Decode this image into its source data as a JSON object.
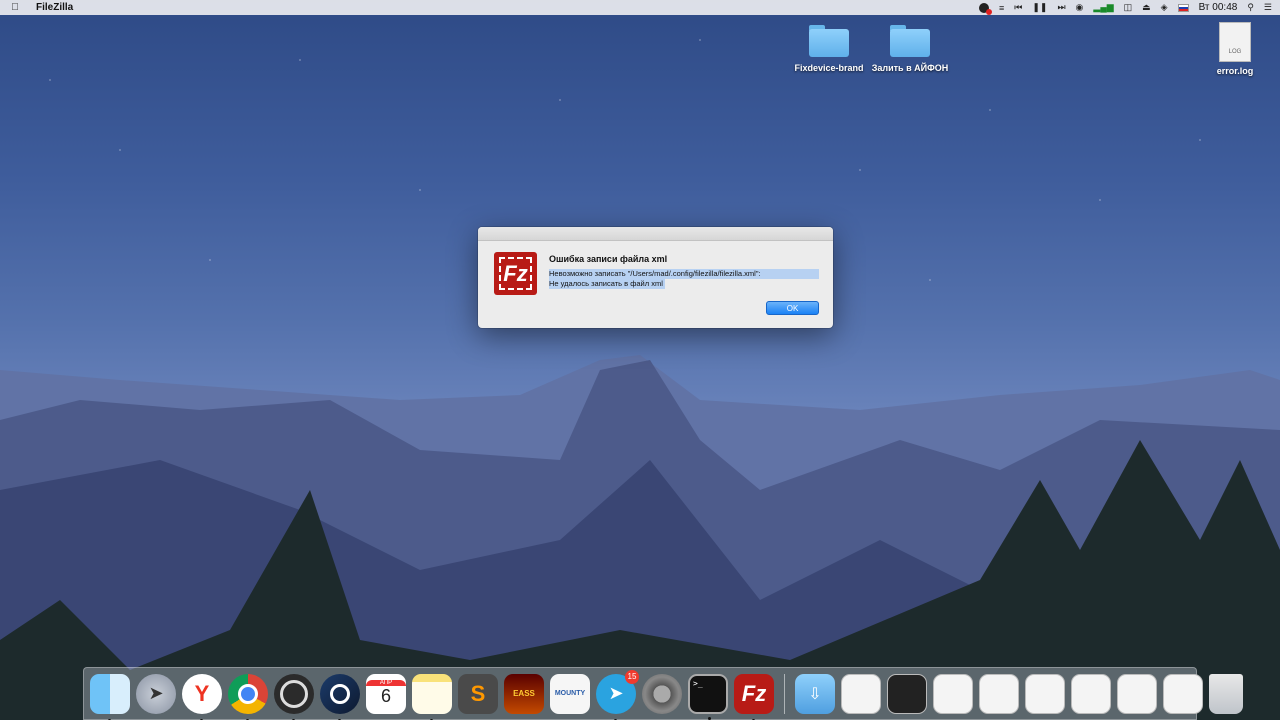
{
  "menubar": {
    "app_name": "FileZilla",
    "clock": "Вт 00:48"
  },
  "desktop": {
    "icons": [
      {
        "label": "Fixdevice-brand",
        "type": "folder"
      },
      {
        "label": "Залить в АЙФОН",
        "type": "folder"
      },
      {
        "label": "error.log",
        "type": "document",
        "badge": "LOG"
      }
    ]
  },
  "dialog": {
    "title": "Ошибка записи файла xml",
    "message_line1": "Невозможно записать \"/Users/mad/.config/filezilla/filezilla.xml\":",
    "message_line2": "Не удалось записать в файл xml",
    "ok_label": "OK",
    "icon": "filezilla-logo-icon",
    "logo_text": "Fz"
  },
  "dock": {
    "apps": [
      {
        "name": "finder-icon",
        "running": true
      },
      {
        "name": "launchpad-icon",
        "running": false
      },
      {
        "name": "yandex-browser-icon",
        "running": true
      },
      {
        "name": "chrome-icon",
        "running": true
      },
      {
        "name": "obs-icon",
        "running": true
      },
      {
        "name": "steam-icon",
        "running": true
      },
      {
        "name": "calendar-icon",
        "running": false,
        "month": "АПР",
        "day": "6"
      },
      {
        "name": "notes-icon",
        "running": true
      },
      {
        "name": "sublime-text-icon",
        "running": false
      },
      {
        "name": "game-icon",
        "running": false,
        "text": "EASS"
      },
      {
        "name": "mounty-icon",
        "running": false,
        "text": "MOUNTY"
      },
      {
        "name": "telegram-icon",
        "running": true,
        "badge": "15"
      },
      {
        "name": "system-preferences-icon",
        "running": false
      },
      {
        "name": "terminal-icon",
        "running": true
      },
      {
        "name": "filezilla-icon",
        "running": true
      }
    ]
  }
}
